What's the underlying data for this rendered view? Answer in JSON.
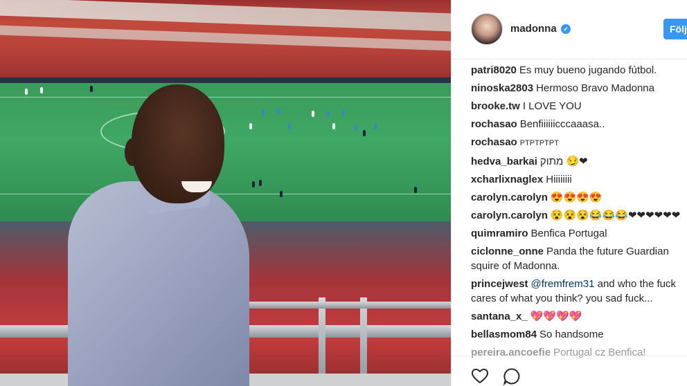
{
  "post": {
    "username": "madonna",
    "follow_label": "Följ",
    "verified_icon": "verified-badge-icon"
  },
  "comments": [
    {
      "user": "patri8020",
      "text": "Es muy bueno jugando fútbol."
    },
    {
      "user": "ninoska2803",
      "text": "Hermoso Bravo Madonna"
    },
    {
      "user": "brooke.tw",
      "text": "I LOVE YOU"
    },
    {
      "user": "rochasao",
      "text": "Benfiiiiiicccaaasa.."
    },
    {
      "user": "rochasao",
      "text": "PTPTPTPT"
    },
    {
      "user": "hedva_barkai",
      "text": "מתוק 😏❤"
    },
    {
      "user": "xcharlixnaglex",
      "text": "Hiiiiiiii"
    },
    {
      "user": "carolyn.carolyn",
      "text": "😍😍😍😍"
    },
    {
      "user": "carolyn.carolyn",
      "text": "😵😵😵😂😂😂❤❤❤❤❤❤"
    },
    {
      "user": "quimramiro",
      "text": "Benfica Portugal"
    },
    {
      "user": "ciclonne_onne",
      "text": "Panda the future Guardian squire of Madonna."
    },
    {
      "user": "princejwest",
      "mention": "@fremfrem31",
      "text": " and who the fuck cares of what you think? you sad fuck..."
    },
    {
      "user": "santana_x_",
      "text": "💖💖💖💖"
    },
    {
      "user": "bellasmom84",
      "text": "So handsome"
    },
    {
      "user": "pereira.ancoefie",
      "text": "Portugal cz Benfica!"
    }
  ],
  "actions": {
    "like_icon": "heart-icon",
    "comment_icon": "comment-icon"
  },
  "colors": {
    "accent": "#3897f0",
    "text": "#262626",
    "mention": "#003569"
  }
}
